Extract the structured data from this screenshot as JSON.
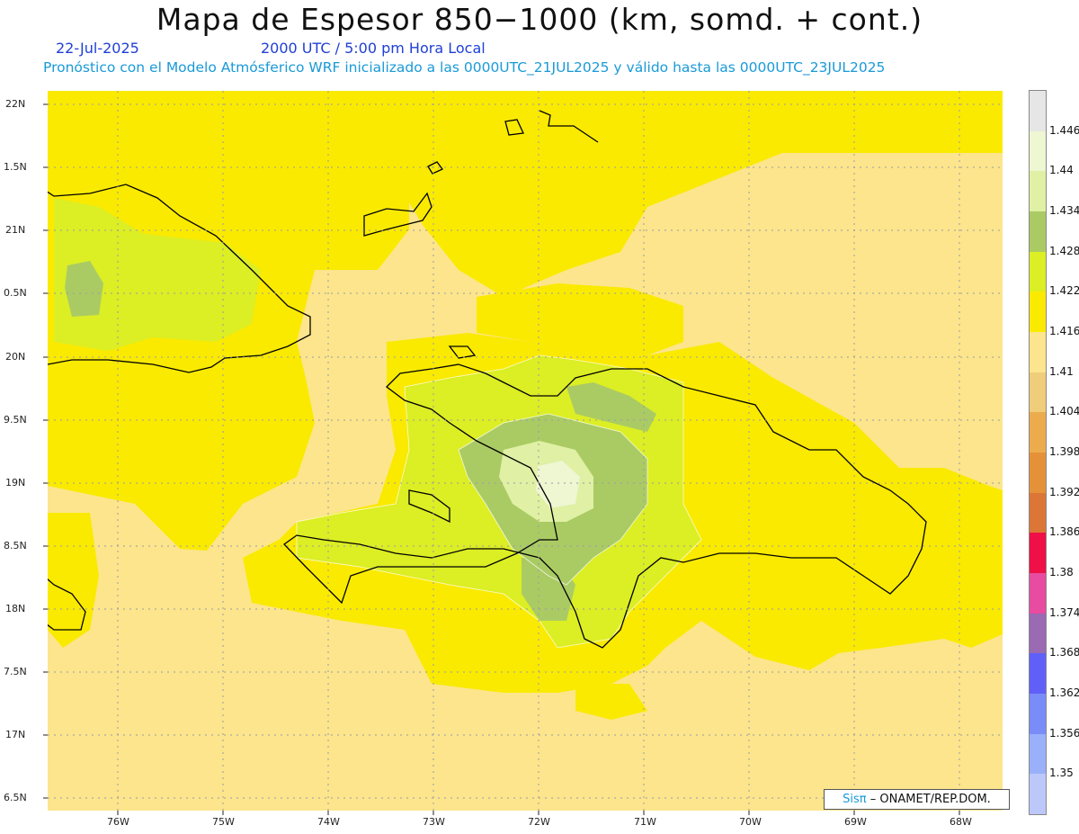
{
  "title": "Mapa de Espesor 850−1000 (km, somd. + cont.)",
  "date": "22-Jul-2025",
  "time": "2000 UTC / 5:00 pm Hora Local",
  "description": "Pronóstico con el Modelo Atmósferico WRF inicializado a las 0000UTC_21JUL2025 y válido hasta las  0000UTC_23JUL2025",
  "credit": {
    "brand": "Sisπ",
    "text": "– ONAMET/REP.DOM."
  },
  "axes": {
    "lat_labels": [
      "22N",
      "1.5N",
      "21N",
      "0.5N",
      "20N",
      "9.5N",
      "19N",
      "8.5N",
      "18N",
      "7.5N",
      "17N",
      "6.5N"
    ],
    "lon_labels": [
      "76W",
      "75W",
      "74W",
      "73W",
      "72W",
      "71W",
      "70W",
      "69W",
      "68W"
    ]
  },
  "colorbar": {
    "labels": [
      "1.446",
      "1.44",
      "1.434",
      "1.428",
      "1.422",
      "1.416",
      "1.41",
      "1.404",
      "1.398",
      "1.392",
      "1.386",
      "1.38",
      "1.374",
      "1.368",
      "1.362",
      "1.356",
      "1.35"
    ],
    "colors": [
      "#e6e6e6",
      "#eef6d2",
      "#e0f0a4",
      "#aacb64",
      "#dcee24",
      "#faea00",
      "#fce58c",
      "#f0cd7a",
      "#ecac4e",
      "#e5913a",
      "#dc7636",
      "#ee1046",
      "#e84ca0",
      "#9a6ab2",
      "#6060f8",
      "#7a8cf8",
      "#9ab0fa",
      "#bcc8fa"
    ]
  },
  "legend_colors": {
    "base": "#fce58c",
    "level_1416": "#faea00",
    "level_1422": "#dcee24",
    "level_1428": "#aacb64",
    "level_1434": "#e0f0a4",
    "level_1440": "#eef6d2",
    "coast": "#000000"
  }
}
